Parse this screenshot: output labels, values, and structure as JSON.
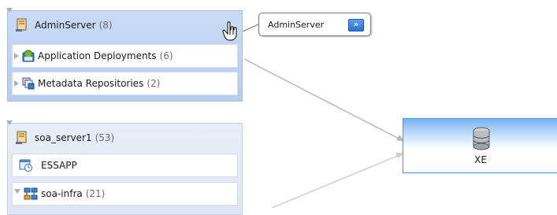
{
  "admin_server": {
    "name": "AdminServer",
    "count": "(8)",
    "children": [
      {
        "label": "Application Deployments",
        "count": "(6)"
      },
      {
        "label": "Metadata Repositories",
        "count": "(2)"
      }
    ]
  },
  "soa_server": {
    "name": "soa_server1",
    "count": "(53)",
    "children": [
      {
        "label": "ESSAPP",
        "count": ""
      },
      {
        "label": "soa-infra",
        "count": "(21)"
      }
    ]
  },
  "db_node": {
    "name": "XE"
  },
  "tooltip": {
    "text": "AdminServer",
    "button_glyph": "»"
  },
  "colors": {
    "selected_group": "#c9dbf6",
    "group": "#e8eef7",
    "node_border": "#4f90d9",
    "connector": "#b8b8b8"
  }
}
